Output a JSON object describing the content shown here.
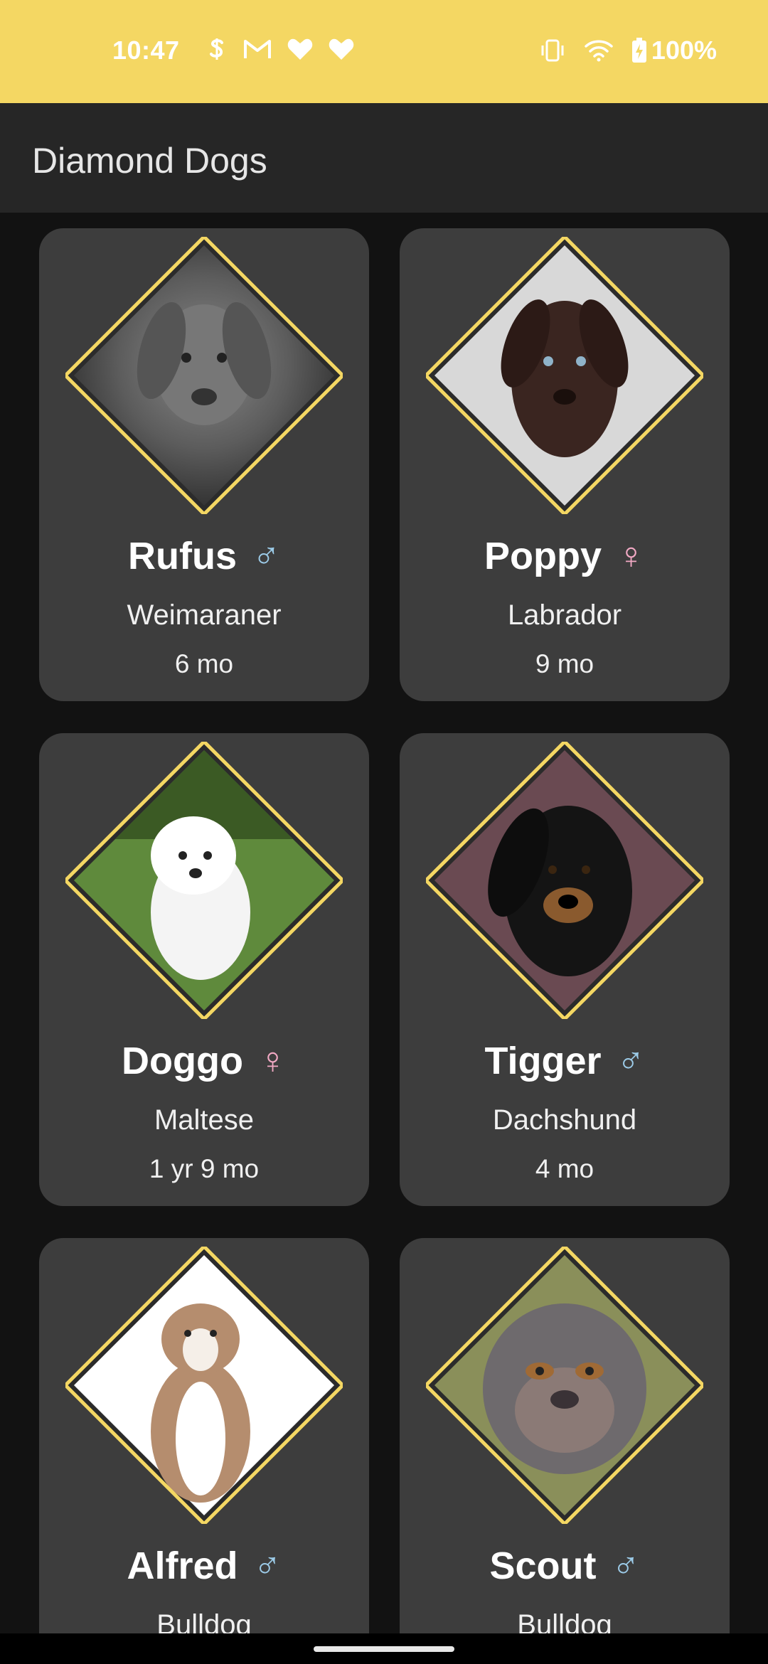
{
  "status_bar": {
    "time": "10:47",
    "battery": "100%",
    "icons": [
      "app-s-icon",
      "gmail-icon",
      "heart-icon",
      "heart-icon",
      "vibrate-icon",
      "wifi-icon",
      "battery-charging-icon"
    ],
    "background": "#f4d763"
  },
  "app_bar": {
    "title": "Diamond Dogs"
  },
  "colors": {
    "accent": "#f4d763",
    "male": "#9ccbe8",
    "female": "#f2a9c4",
    "card": "#3d3d3d"
  },
  "dogs": [
    {
      "name": "Rufus",
      "gender": "male",
      "gender_symbol": "♂",
      "breed": "Weimaraner",
      "age": "6 mo"
    },
    {
      "name": "Poppy",
      "gender": "female",
      "gender_symbol": "♀",
      "breed": "Labrador",
      "age": "9 mo"
    },
    {
      "name": "Doggo",
      "gender": "female",
      "gender_symbol": "♀",
      "breed": "Maltese",
      "age": "1 yr 9 mo"
    },
    {
      "name": "Tigger",
      "gender": "male",
      "gender_symbol": "♂",
      "breed": "Dachshund",
      "age": "4 mo"
    },
    {
      "name": "Alfred",
      "gender": "male",
      "gender_symbol": "♂",
      "breed": "Bulldog",
      "age": ""
    },
    {
      "name": "Scout",
      "gender": "male",
      "gender_symbol": "♂",
      "breed": "Bulldog",
      "age": ""
    }
  ]
}
